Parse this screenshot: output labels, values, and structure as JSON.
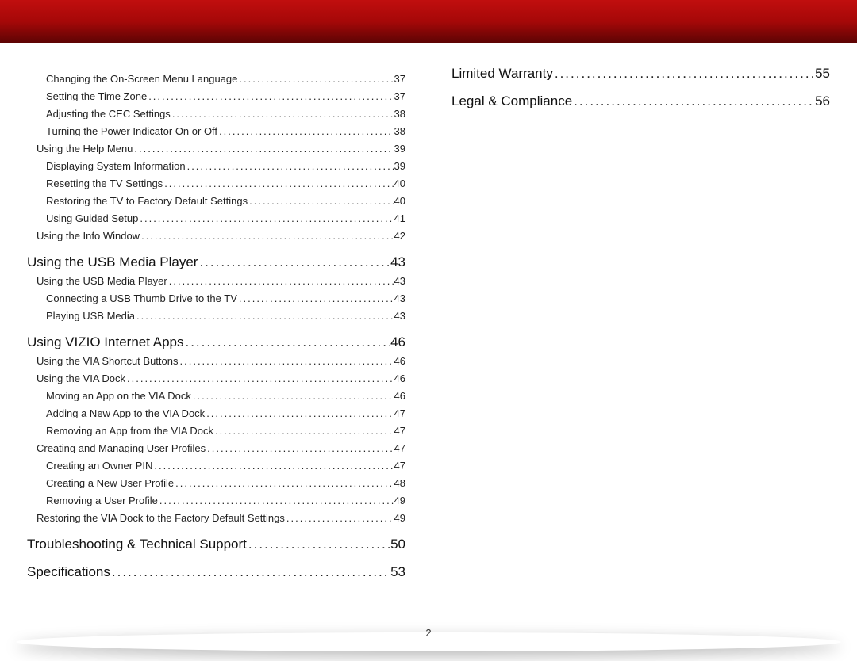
{
  "page_number": "2",
  "columns": [
    {
      "entries": [
        {
          "level": 2,
          "label": "Changing the On-Screen Menu Language",
          "page": "37"
        },
        {
          "level": 2,
          "label": "Setting the Time Zone",
          "page": "37"
        },
        {
          "level": 2,
          "label": "Adjusting the CEC Settings",
          "page": "38"
        },
        {
          "level": 2,
          "label": "Turning the Power Indicator On or Off",
          "page": "38"
        },
        {
          "level": 1,
          "label": "Using the Help Menu",
          "page": "39"
        },
        {
          "level": 2,
          "label": "Displaying System Information",
          "page": "39"
        },
        {
          "level": 2,
          "label": "Resetting the TV Settings",
          "page": "40"
        },
        {
          "level": 2,
          "label": "Restoring the TV to Factory Default Settings",
          "page": "40"
        },
        {
          "level": 2,
          "label": "Using Guided Setup",
          "page": "41"
        },
        {
          "level": 1,
          "label": "Using the Info Window",
          "page": "42"
        },
        {
          "level": 0,
          "label": "Using the USB Media Player",
          "page": "43"
        },
        {
          "level": 1,
          "label": "Using the USB Media Player",
          "page": "43"
        },
        {
          "level": 2,
          "label": "Connecting a USB Thumb Drive to the TV",
          "page": "43"
        },
        {
          "level": 2,
          "label": "Playing USB Media",
          "page": "43"
        },
        {
          "level": 0,
          "label": "Using VIZIO Internet Apps",
          "page": "46"
        },
        {
          "level": 1,
          "label": "Using the VIA Shortcut Buttons",
          "page": "46"
        },
        {
          "level": 1,
          "label": "Using the VIA Dock",
          "page": "46"
        },
        {
          "level": 2,
          "label": "Moving an App on the VIA Dock",
          "page": "46"
        },
        {
          "level": 2,
          "label": "Adding a New App to the VIA Dock",
          "page": "47"
        },
        {
          "level": 2,
          "label": "Removing an App from the VIA Dock",
          "page": "47"
        },
        {
          "level": 1,
          "label": "Creating and Managing User Profiles",
          "page": "47"
        },
        {
          "level": 2,
          "label": "Creating an Owner PIN",
          "page": "47"
        },
        {
          "level": 2,
          "label": "Creating a New User Profile",
          "page": "48"
        },
        {
          "level": 2,
          "label": "Removing a User Profile",
          "page": "49"
        },
        {
          "level": 1,
          "label": "Restoring the VIA Dock to the Factory Default Settings",
          "page": "49"
        },
        {
          "level": 0,
          "label": "Troubleshooting & Technical Support",
          "page": "50"
        },
        {
          "level": 0,
          "label": "Specifications",
          "page": "53"
        }
      ]
    },
    {
      "entries": [
        {
          "level": 0,
          "label": "Limited Warranty",
          "page": "55"
        },
        {
          "level": 0,
          "label": "Legal & Compliance",
          "page": "56"
        }
      ]
    }
  ]
}
